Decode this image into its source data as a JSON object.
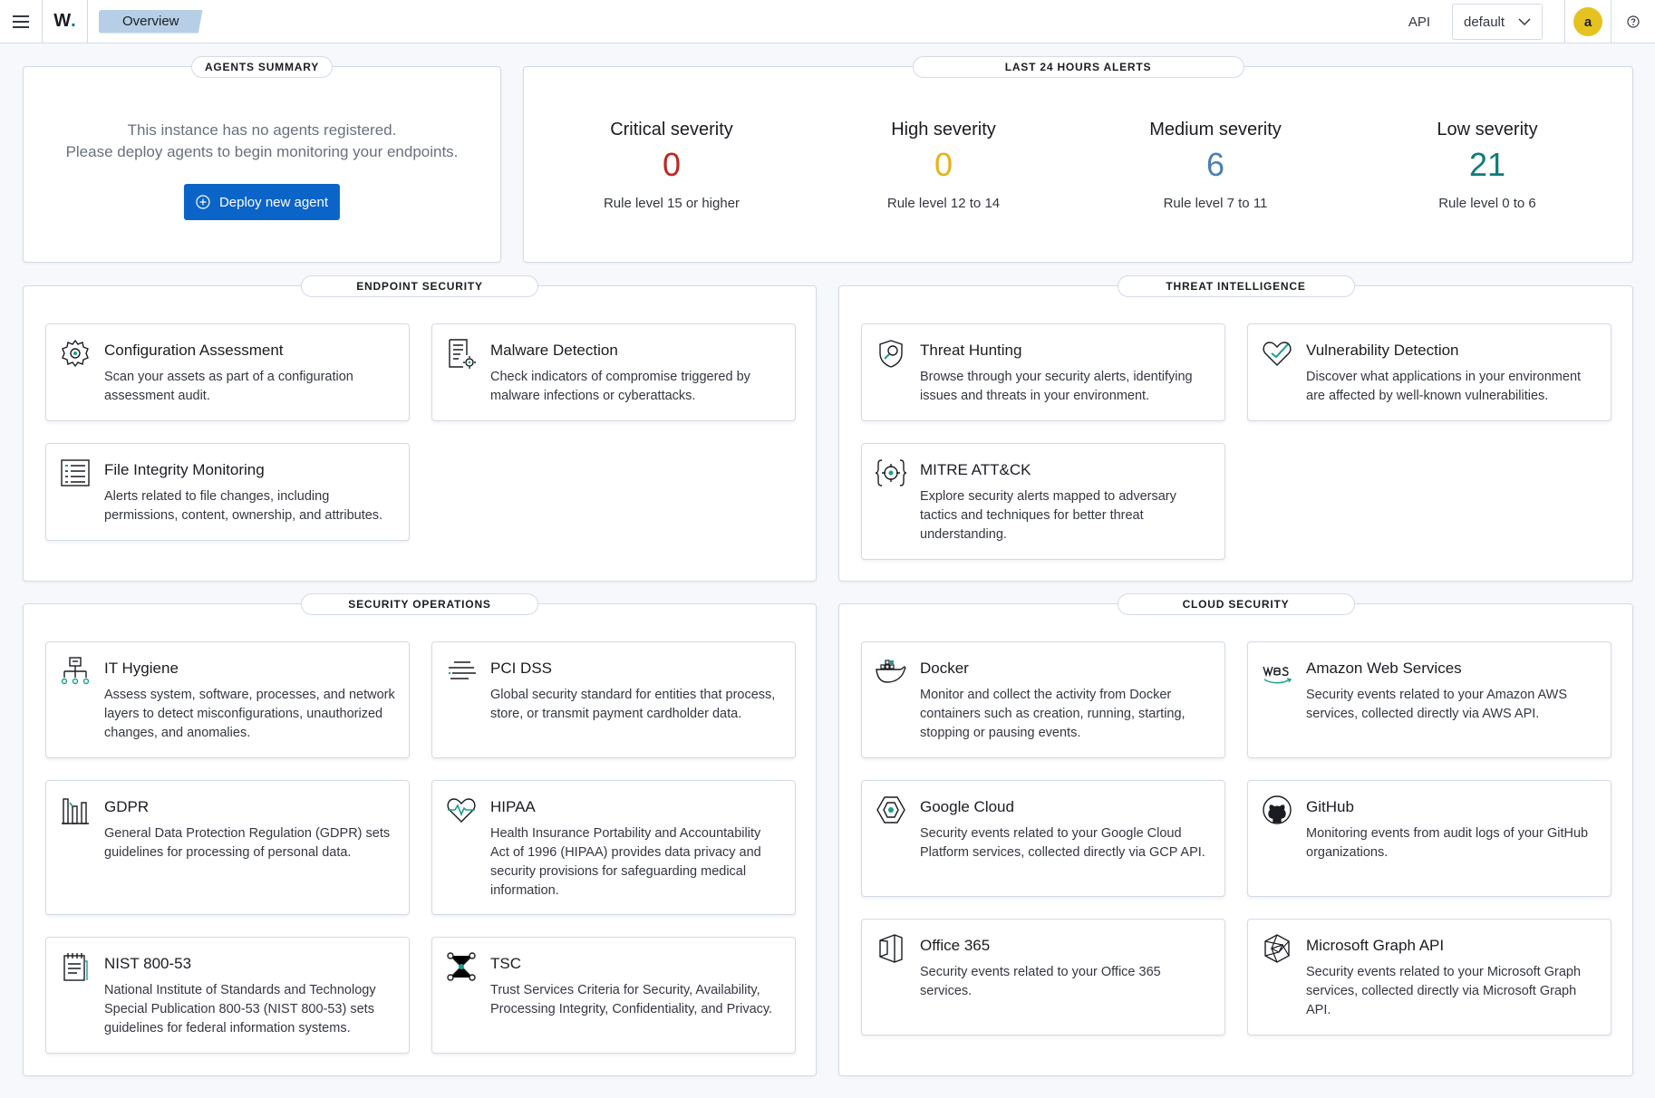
{
  "header": {
    "breadcrumb": "Overview",
    "api_label": "API",
    "api_select": "default",
    "avatar_letter": "a"
  },
  "agents_summary": {
    "title": "AGENTS SUMMARY",
    "message_line1": "This instance has no agents registered.",
    "message_line2": "Please deploy agents to begin monitoring your endpoints.",
    "deploy_button": "Deploy new agent"
  },
  "alerts": {
    "title": "LAST 24 HOURS ALERTS",
    "items": [
      {
        "name": "Critical severity",
        "value": "0",
        "rule": "Rule level 15 or higher",
        "color": "#bd271e"
      },
      {
        "name": "High severity",
        "value": "0",
        "rule": "Rule level 12 to 14",
        "color": "#e5b318"
      },
      {
        "name": "Medium severity",
        "value": "6",
        "rule": "Rule level 7 to 11",
        "color": "#4a7fb7"
      },
      {
        "name": "Low severity",
        "value": "21",
        "rule": "Rule level 0 to 6",
        "color": "#0f7b7a"
      }
    ]
  },
  "endpoint_security": {
    "title": "ENDPOINT SECURITY",
    "cards": [
      {
        "icon": "gear-icon",
        "title": "Configuration Assessment",
        "desc": "Scan your assets as part of a configuration assessment audit."
      },
      {
        "icon": "document-gear-icon",
        "title": "Malware Detection",
        "desc": "Check indicators of compromise triggered by malware infections or cyberattacks."
      },
      {
        "icon": "list-icon",
        "title": "File Integrity Monitoring",
        "desc": "Alerts related to file changes, including permissions, content, ownership, and attributes."
      }
    ]
  },
  "threat_intelligence": {
    "title": "THREAT INTELLIGENCE",
    "cards": [
      {
        "icon": "shield-search-icon",
        "title": "Threat Hunting",
        "desc": "Browse through your security alerts, identifying issues and threats in your environment."
      },
      {
        "icon": "heart-check-icon",
        "title": "Vulnerability Detection",
        "desc": "Discover what applications in your environment are affected by well-known vulnerabilities."
      },
      {
        "icon": "target-brackets-icon",
        "title": "MITRE ATT&CK",
        "desc": "Explore security alerts mapped to adversary tactics and techniques for better threat understanding."
      }
    ]
  },
  "security_operations": {
    "title": "SECURITY OPERATIONS",
    "cards": [
      {
        "icon": "network-icon",
        "title": "IT Hygiene",
        "desc": "Assess system, software, processes, and network layers to detect misconfigurations, unauthorized changes, and anomalies."
      },
      {
        "icon": "lines-icon",
        "title": "PCI DSS",
        "desc": "Global security standard for entities that process, store, or transmit payment cardholder data."
      },
      {
        "icon": "bar-chart-icon",
        "title": "GDPR",
        "desc": "General Data Protection Regulation (GDPR) sets guidelines for processing of personal data."
      },
      {
        "icon": "heart-pulse-icon",
        "title": "HIPAA",
        "desc": "Health Insurance Portability and Accountability Act of 1996 (HIPAA) provides data privacy and security provisions for safeguarding medical information."
      },
      {
        "icon": "notepad-icon",
        "title": "NIST 800-53",
        "desc": "National Institute of Standards and Technology Special Publication 800-53 (NIST 800-53) sets guidelines for federal information systems."
      },
      {
        "icon": "nodes-icon",
        "title": "TSC",
        "desc": "Trust Services Criteria for Security, Availability, Processing Integrity, Confidentiality, and Privacy."
      }
    ]
  },
  "cloud_security": {
    "title": "CLOUD SECURITY",
    "cards": [
      {
        "icon": "docker-icon",
        "title": "Docker",
        "desc": "Monitor and collect the activity from Docker containers such as creation, running, starting, stopping or pausing events."
      },
      {
        "icon": "aws-icon",
        "title": "Amazon Web Services",
        "desc": "Security events related to your Amazon AWS services, collected directly via AWS API."
      },
      {
        "icon": "google-cloud-icon",
        "title": "Google Cloud",
        "desc": "Security events related to your Google Cloud Platform services, collected directly via GCP API."
      },
      {
        "icon": "github-icon",
        "title": "GitHub",
        "desc": "Monitoring events from audit logs of your GitHub organizations."
      },
      {
        "icon": "office365-icon",
        "title": "Office 365",
        "desc": "Security events related to your Office 365 services."
      },
      {
        "icon": "microsoft-graph-icon",
        "title": "Microsoft Graph API",
        "desc": "Security events related to your Microsoft Graph services, collected directly via Microsoft Graph API."
      }
    ]
  }
}
